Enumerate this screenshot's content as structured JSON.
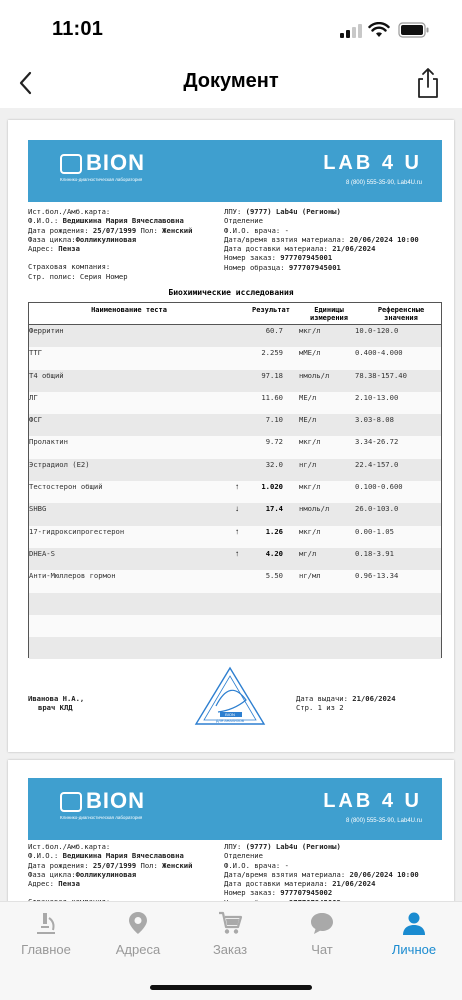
{
  "status_bar": {
    "time": "11:01"
  },
  "nav": {
    "title": "Документ"
  },
  "doc": {
    "bion": "BION",
    "bion_sub": "Клинико-диагностическая лаборатория",
    "lab4u": "LAB 4 U",
    "lab_phone": "8 (800) 555-35-90, Lab4U.ru",
    "patient": {
      "card": "Ист.бол./Амб.карта:",
      "fio_label": "Ф.И.О.:",
      "fio": "Ведишкина Мария Вячеславовна",
      "dob_label": "Дата рождения:",
      "dob": "25/07/1999",
      "sex_label": "Пол:",
      "sex": "Женский",
      "phase_label": "Фаза цикла:",
      "phase": "Фолликулиновая",
      "address_label": "Адрес:",
      "address": "Пенза",
      "insurance": "Страховая компания:",
      "policy": "Стр. полис: Серия  Номер"
    },
    "lpu": {
      "lpu_label": "ЛПУ:",
      "lpu": "(9777) Lab4u (Регионы)",
      "department": "Отделение",
      "doctor": "Ф.И.О. врача: -",
      "taken_label": "Дата/время взятия материала:",
      "taken": "20/06/2024 10:00",
      "delivered_label": "Дата доставки материала:",
      "delivered": "21/06/2024",
      "order_label": "Номер заказ:",
      "order": "977707945001",
      "sample_label": "Номер образца:",
      "sample": "977707945001"
    },
    "section_title": "Биохимические исследования",
    "table_headers": {
      "name": "Наименование теста",
      "result": "Результат",
      "unit": "Единицы измерения",
      "ref": "Референсные значения"
    },
    "rows": [
      {
        "name": "Ферритин",
        "result": "60.7",
        "arrow": "",
        "unit": "мкг/л",
        "ref": "10.0-120.0"
      },
      {
        "name": "ТТГ",
        "result": "2.259",
        "arrow": "",
        "unit": "мМЕ/л",
        "ref": "0.400-4.000"
      },
      {
        "name": "Т4 общий",
        "result": "97.18",
        "arrow": "",
        "unit": "нмоль/л",
        "ref": "78.38-157.40"
      },
      {
        "name": "ЛГ",
        "result": "11.60",
        "arrow": "",
        "unit": "МЕ/л",
        "ref": "2.10-13.00"
      },
      {
        "name": "ФСГ",
        "result": "7.10",
        "arrow": "",
        "unit": "МЕ/л",
        "ref": "3.03-8.08"
      },
      {
        "name": "Пролактин",
        "result": "9.72",
        "arrow": "",
        "unit": "мкг/л",
        "ref": "3.34-26.72"
      },
      {
        "name": "Эстрадиол (Е2)",
        "result": "32.0",
        "arrow": "",
        "unit": "нг/л",
        "ref": "22.4-157.0"
      },
      {
        "name": "Тестостерон общий",
        "result": "1.020",
        "arrow": "↑",
        "unit": "мкг/л",
        "ref": "0.100-0.600"
      },
      {
        "name": "SHBG",
        "result": "17.4",
        "arrow": "↓",
        "unit": "нмоль/л",
        "ref": "26.0-103.0"
      },
      {
        "name": "17-гидроксипрогестерон",
        "result": "1.26",
        "arrow": "↑",
        "unit": "мкг/л",
        "ref": "0.00-1.05"
      },
      {
        "name": "DHEA-S",
        "result": "4.20",
        "arrow": "↑",
        "unit": "мг/л",
        "ref": "0.18-3.91"
      },
      {
        "name": "Анти-Мюллеров гормон",
        "result": "5.50",
        "arrow": "",
        "unit": "нг/мл",
        "ref": "0.96-13.34"
      }
    ],
    "footer": {
      "doctor_name": "Иванова Н.А.,",
      "doctor_role": "врач КЛД",
      "issued_label": "Дата выдачи:",
      "issued": "21/06/2024",
      "page": "Стр. 1 из 2"
    },
    "stamp_text": "ДЛЯ АНАЛИЗОВ",
    "page2": {
      "order": "977707945002",
      "sample": "977707945002"
    }
  },
  "tabs": [
    {
      "label": "Главное",
      "icon": "microscope-icon"
    },
    {
      "label": "Адреса",
      "icon": "map-pin-icon"
    },
    {
      "label": "Заказ",
      "icon": "cart-icon"
    },
    {
      "label": "Чат",
      "icon": "chat-icon"
    },
    {
      "label": "Личное",
      "icon": "person-icon"
    }
  ],
  "colors": {
    "accent": "#1a8bd0",
    "header_blue": "#3f9fcf",
    "inactive_tab": "#999999"
  }
}
